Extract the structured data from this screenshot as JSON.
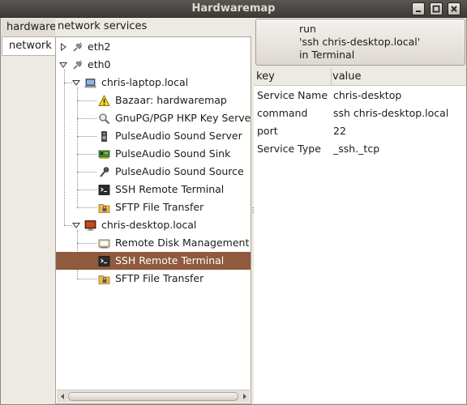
{
  "window": {
    "title": "Hardwaremap"
  },
  "tabs": [
    {
      "label": "hardware"
    },
    {
      "label": "network"
    }
  ],
  "tree": {
    "header": "network services",
    "rows": [
      {
        "label": "eth2",
        "icon": "network-plug-icon",
        "depth": 0,
        "expander": "collapsed",
        "selected": false
      },
      {
        "label": "eth0",
        "icon": "network-plug-icon",
        "depth": 0,
        "expander": "expanded",
        "selected": false
      },
      {
        "label": "chris-laptop.local",
        "icon": "laptop-icon",
        "depth": 1,
        "expander": "expanded",
        "selected": false
      },
      {
        "label": "Bazaar: hardwaremap",
        "icon": "warning-icon",
        "depth": 2,
        "expander": "none",
        "selected": false
      },
      {
        "label": "GnuPG/PGP HKP Key Server",
        "icon": "key-search-icon",
        "depth": 2,
        "expander": "none",
        "selected": false
      },
      {
        "label": "PulseAudio Sound Server",
        "icon": "audio-server-icon",
        "depth": 2,
        "expander": "none",
        "selected": false
      },
      {
        "label": "PulseAudio Sound Sink",
        "icon": "sound-card-icon",
        "depth": 2,
        "expander": "none",
        "selected": false
      },
      {
        "label": "PulseAudio Sound Source",
        "icon": "microphone-icon",
        "depth": 2,
        "expander": "none",
        "selected": false
      },
      {
        "label": "SSH Remote Terminal",
        "icon": "terminal-icon",
        "depth": 2,
        "expander": "none",
        "selected": false
      },
      {
        "label": "SFTP File Transfer",
        "icon": "folder-lock-icon",
        "depth": 2,
        "expander": "none",
        "selected": false
      },
      {
        "label": "chris-desktop.local",
        "icon": "desktop-icon",
        "depth": 1,
        "expander": "expanded",
        "selected": false
      },
      {
        "label": "Remote Disk Management",
        "icon": "disk-manager-icon",
        "depth": 2,
        "expander": "none",
        "selected": false
      },
      {
        "label": "SSH Remote Terminal",
        "icon": "terminal-icon",
        "depth": 2,
        "expander": "none",
        "selected": true
      },
      {
        "label": "SFTP File Transfer",
        "icon": "folder-lock-icon",
        "depth": 2,
        "expander": "none",
        "selected": false
      }
    ]
  },
  "run_button": {
    "lines": [
      "run",
      "'ssh chris-desktop.local'",
      "in Terminal"
    ]
  },
  "properties": {
    "columns": [
      "key",
      "value"
    ],
    "rows": [
      {
        "key": "Service Name",
        "value": "chris-desktop"
      },
      {
        "key": "command",
        "value": "ssh chris-desktop.local"
      },
      {
        "key": "port",
        "value": "22"
      },
      {
        "key": "Service Type",
        "value": "_ssh._tcp"
      }
    ]
  },
  "colors": {
    "selection": "#8f5a3d",
    "titlebar": "#3c3b37",
    "background": "#ede9e3"
  }
}
